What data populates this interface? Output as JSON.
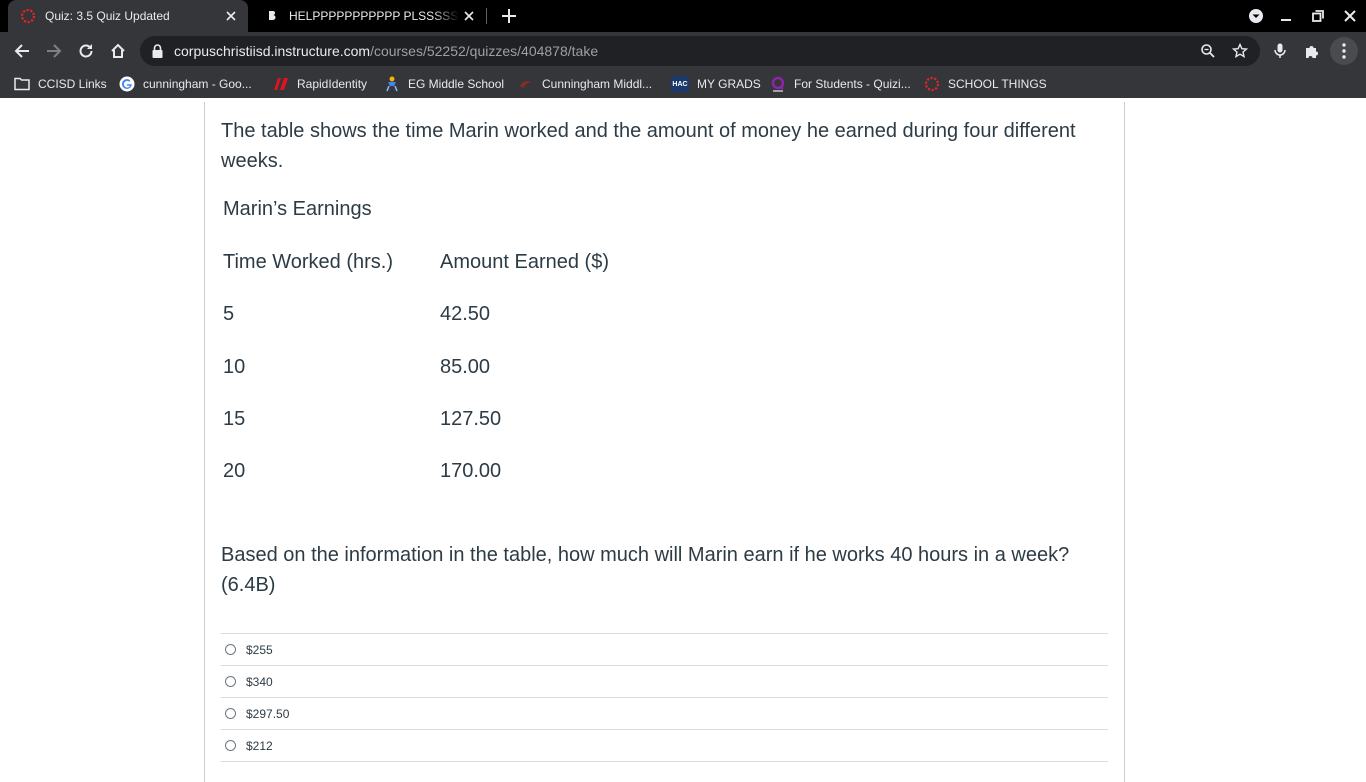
{
  "browser": {
    "tabs": [
      {
        "title": "Quiz: 3.5 Quiz Updated",
        "active": true,
        "icon": "canvas-icon"
      },
      {
        "title": "HELPPPPPPPPPPP PLSSSSS A",
        "active": false,
        "icon": "brainly-icon"
      }
    ],
    "url": {
      "host": "corpuschristiisd.instructure.com",
      "path": "/courses/52252/quizzes/404878/take"
    },
    "bookmarks": [
      {
        "label": "CCISD Links",
        "icon": "folder-icon"
      },
      {
        "label": "cunningham - Goo...",
        "icon": "google-icon"
      },
      {
        "label": "RapidIdentity",
        "icon": "rapididentity-icon"
      },
      {
        "label": "EG Middle School",
        "icon": "school-icon"
      },
      {
        "label": "Cunningham Middl...",
        "icon": "cunningham-icon"
      },
      {
        "label": "MY GRADS",
        "icon": "hac-icon"
      },
      {
        "label": "For Students - Quizi...",
        "icon": "quizizz-icon"
      },
      {
        "label": "SCHOOL THINGS",
        "icon": "canvas-icon"
      }
    ],
    "hac_badge": "HAC",
    "colors": {
      "tabstrip": "#000000",
      "toolbar": "#35363a",
      "omnibox": "#202124",
      "canvas_red": "#e72429"
    }
  },
  "quiz": {
    "intro": "The table shows the time Marin worked and the amount of money he earned during four different weeks.",
    "table": {
      "title": "Marin’s Earnings",
      "headers": [
        "Time Worked (hrs.)",
        "Amount Earned ($)"
      ],
      "rows": [
        [
          "5",
          "42.50"
        ],
        [
          "10",
          "85.00"
        ],
        [
          "15",
          "127.50"
        ],
        [
          "20",
          "170.00"
        ]
      ]
    },
    "question": "Based on the information in the table, how much will Marin earn if he works 40 hours in a week? (6.4B)",
    "answers": [
      "$255",
      "$340",
      "$297.50",
      "$212"
    ],
    "colors": {
      "text": "#2d3b45",
      "divider": "#d8dcdf"
    }
  }
}
